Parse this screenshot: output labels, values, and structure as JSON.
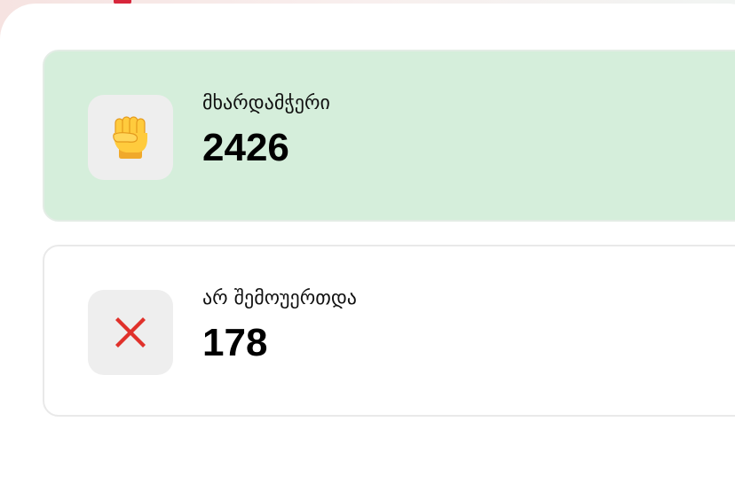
{
  "stats": [
    {
      "label": "მხარდამჭერი",
      "value": "2426",
      "icon": "raised-fist-icon",
      "background_color": "#d5eedb"
    },
    {
      "label": "არ შემოუერთდა",
      "value": "178",
      "icon": "cross-mark-icon",
      "background_color": "#ffffff"
    }
  ],
  "colors": {
    "accent": "#d7263b",
    "supporters_card": "#d5eedb",
    "icon_box": "#eeeeee"
  }
}
